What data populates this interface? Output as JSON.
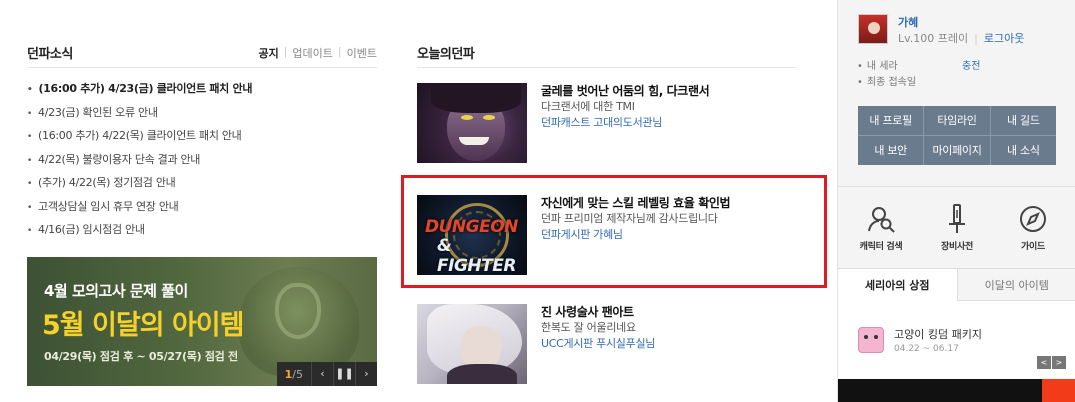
{
  "news": {
    "title": "던파소식",
    "tabs": [
      "공지",
      "업데이트",
      "이벤트"
    ],
    "items": [
      "(16:00 추가) 4/23(금) 클라이언트 패치 안내",
      "4/23(금) 확인된 오류 안내",
      "(16:00 추가) 4/22(목) 클라이언트 패치 안내",
      "4/22(목) 불량이용자 단속 결과 안내",
      "(추가) 4/22(목) 정기점검 안내",
      "고객상담실 임시 휴무 연장 안내",
      "4/16(금) 임시점검 안내"
    ]
  },
  "banner": {
    "line1": "4월 모의고사 문제 풀이",
    "line2": "5월 이달의 아이템",
    "line3": "04/29(목) 점검 후 ~ 05/27(목) 점검 전",
    "page_current": "1",
    "page_total": "/5"
  },
  "today": {
    "title": "오늘의던파",
    "items": [
      {
        "title": "굴레를 벗어난 어둠의 힘, 다크랜서",
        "desc": "다크랜서에 대한 TMI",
        "author": "던파캐스트 고대의도서관님"
      },
      {
        "title": "자신에게 맞는 스킬 레벨링 효율 확인법",
        "desc": "던파 프리미엄 제작자님께 감사드립니다",
        "author": "던파게시판 가혜님"
      },
      {
        "title": "진 사령술사 팬아트",
        "desc": "한복도 잘 어울리네요",
        "author": "UCC게시판 푸시실푸실님"
      }
    ],
    "thumb2_logo1": "DUNGEON",
    "thumb2_logo2": "& FIGHTER"
  },
  "sidebar": {
    "user_name": "가혜",
    "level": "Lv.100 프레이",
    "logout": "로그아웃",
    "seria_label": "내 세라",
    "charge": "충전",
    "last_login_label": "최종 접속일",
    "menu": [
      "내 프로필",
      "타임라인",
      "내 길드",
      "내 보안",
      "마이페이지",
      "내 소식"
    ],
    "tools": [
      "캐릭터 검색",
      "장비사전",
      "가이드"
    ],
    "tabs": [
      "세리아의 상점",
      "이달의 아이템"
    ],
    "shop": {
      "name": "고양이 킹덤 패키지",
      "date": "04.22 ~ 06.17"
    }
  },
  "colors": {
    "highlight": "#e11b22",
    "link": "#2f6ab3",
    "menu": "#6b7b8e",
    "banner_title": "#f6d12a"
  }
}
